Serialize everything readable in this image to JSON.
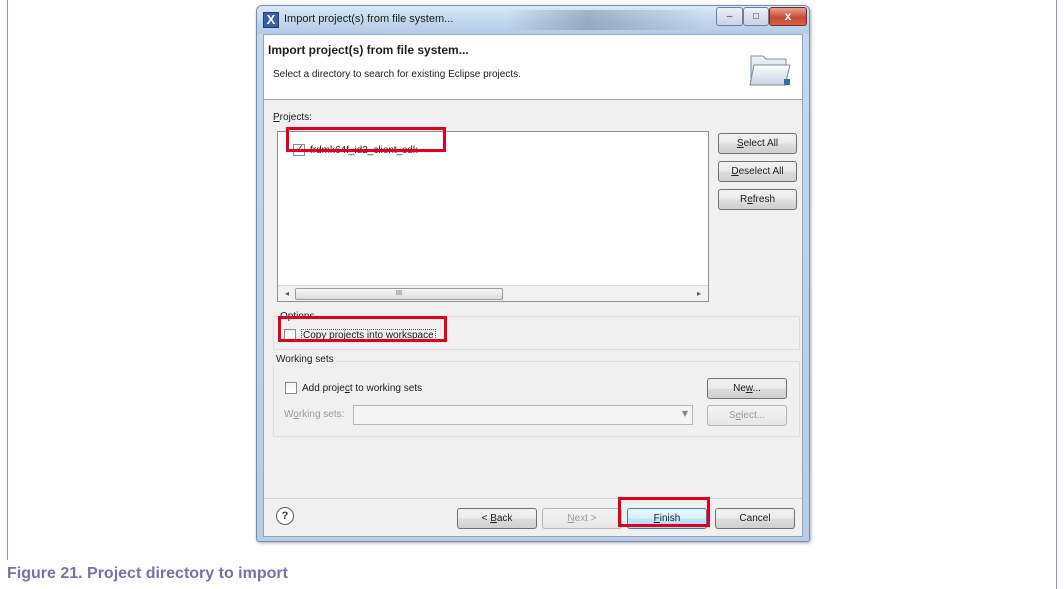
{
  "window": {
    "title": "Import project(s) from file system...",
    "app_icon": "X",
    "controls": {
      "minimize": "–",
      "maximize": "□",
      "close": "x"
    }
  },
  "header": {
    "title": "Import project(s) from file system...",
    "description": "Select a directory to search for existing Eclipse projects.",
    "icon": "folder-open-icon"
  },
  "projects": {
    "label_prefix": "",
    "label_mnemonic": "P",
    "label_rest": "rojects:",
    "items": [
      {
        "name": "frdmk64f_id2_client_sdk",
        "checked": true
      }
    ],
    "scrollbar_grip": "III",
    "scroll_left": "◂",
    "scroll_right": "▸"
  },
  "side_buttons": {
    "select_all": {
      "mnemonic": "S",
      "rest": "elect All"
    },
    "deselect_all": {
      "mnemonic": "D",
      "rest": "eselect All"
    },
    "refresh": {
      "pre": "R",
      "mnemonic": "e",
      "rest": "fresh"
    }
  },
  "options": {
    "label": "Options",
    "copy_pre": "",
    "copy_mnemonic": "C",
    "copy_rest": "opy projects into workspace",
    "copy_checked": false
  },
  "working_sets": {
    "label": "Working sets",
    "add_pre": "Add proje",
    "add_mnemonic": "c",
    "add_rest": "t to working sets",
    "add_checked": false,
    "field_pre": "W",
    "field_mnemonic": "o",
    "field_rest": "rking sets:",
    "field_value": "",
    "new_pre": "Ne",
    "new_mnemonic": "w",
    "new_rest": "...",
    "select_pre": "S",
    "select_mnemonic": "e",
    "select_rest": "lect..."
  },
  "footer": {
    "help": "?",
    "back_pre": "< ",
    "back_mnemonic": "B",
    "back_rest": "ack",
    "next_mnemonic": "N",
    "next_rest": "ext >",
    "finish_mnemonic": "F",
    "finish_rest": "inish",
    "cancel": "Cancel"
  },
  "highlight_color": "#e2001a",
  "caption": "Figure 21.  Project directory to import"
}
